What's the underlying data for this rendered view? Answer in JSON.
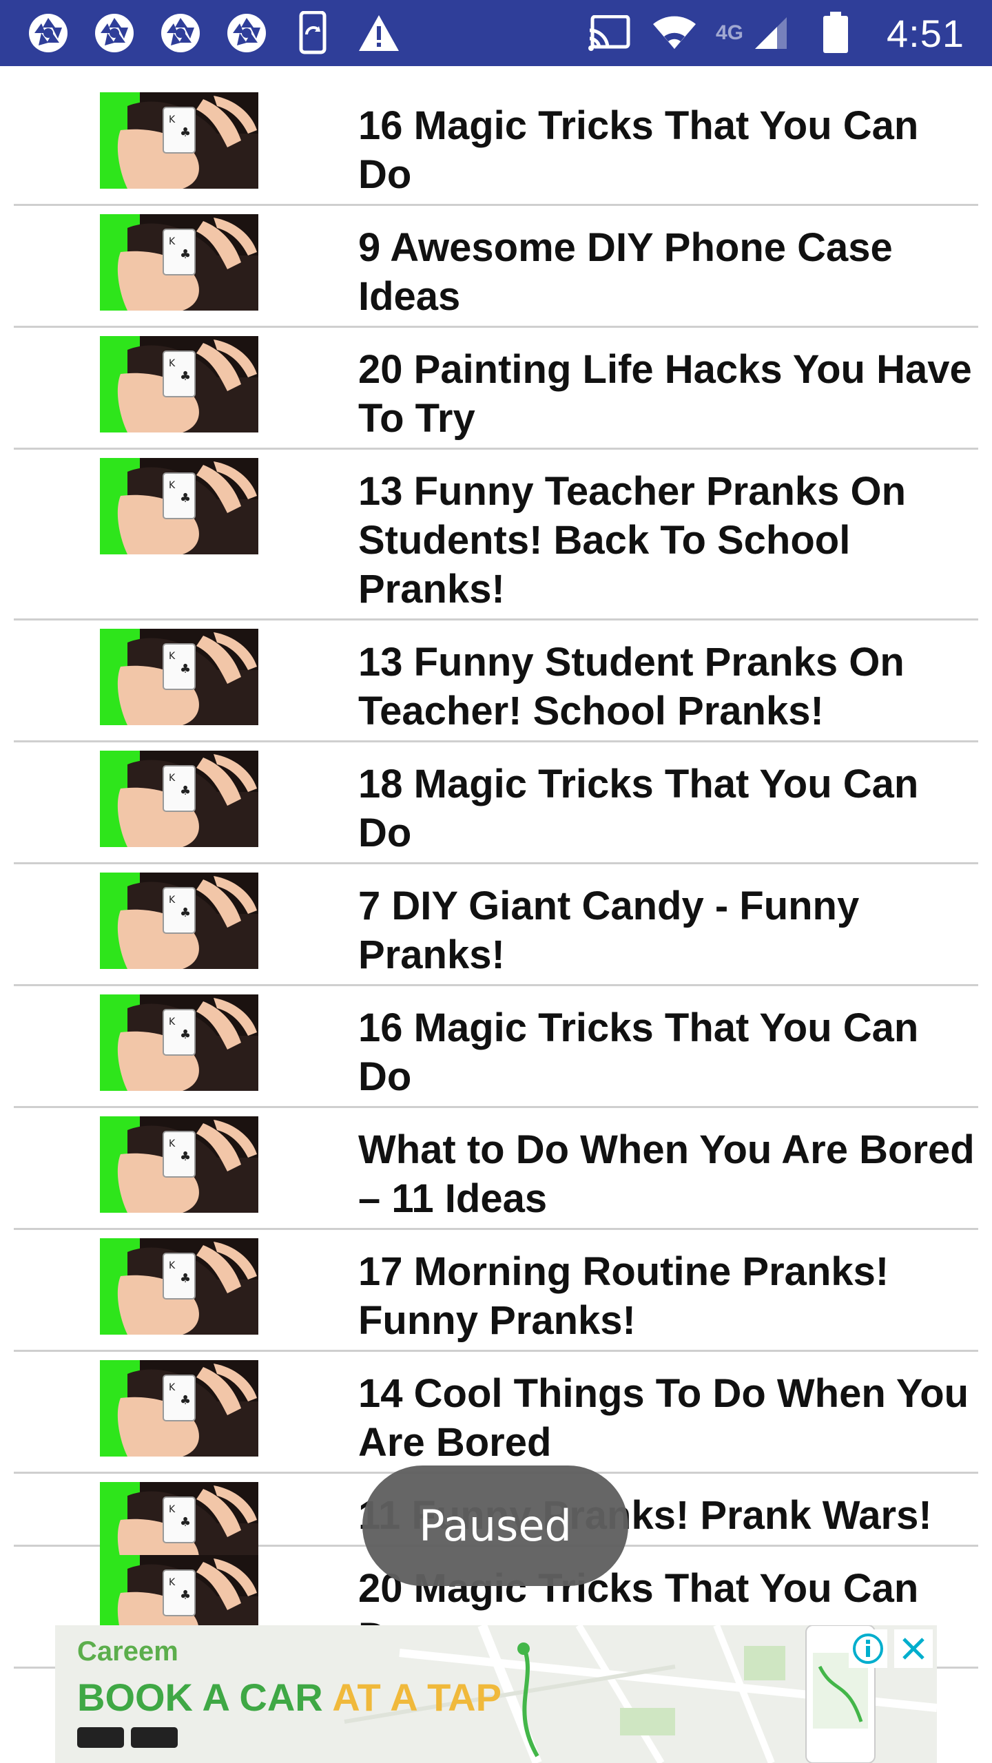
{
  "status_bar": {
    "clock": "4:51",
    "network_label": "4G",
    "left_icons": [
      "camera-shutter-icon",
      "camera-shutter-icon",
      "camera-shutter-icon",
      "camera-shutter-icon",
      "phone-rotate-icon",
      "warning-icon"
    ],
    "right_icons": [
      "cast-icon",
      "wifi-icon",
      "signal-icon",
      "battery-icon"
    ],
    "bg_color": "#2f3e99"
  },
  "list": {
    "items": [
      {
        "title": "16 Magic Tricks That You Can Do"
      },
      {
        "title": "9 Awesome DIY Phone Case Ideas"
      },
      {
        "title": "20 Painting Life Hacks You Have To Try"
      },
      {
        "title": "13 Funny Teacher Pranks On Students! Back To School Pranks!"
      },
      {
        "title": "13 Funny Student Pranks On Teacher! School Pranks!"
      },
      {
        "title": "18 Magic Tricks That You Can Do"
      },
      {
        "title": "7 DIY Giant Candy - Funny Pranks!"
      },
      {
        "title": "16 Magic Tricks That You Can Do"
      },
      {
        "title": "What to Do When You Are Bored – 11 Ideas"
      },
      {
        "title": "17 Morning Routine Pranks! Funny Pranks!"
      },
      {
        "title": "14 Cool Things To Do When You Are Bored"
      },
      {
        "title": "11 Funny Pranks! Prank Wars!"
      },
      {
        "title": "20 Magic Tricks That You Can Do"
      }
    ]
  },
  "toast": {
    "text": "Paused"
  },
  "ad": {
    "brand": "Careem",
    "headline_main": "BOOK A CAR",
    "headline_accent": "AT A TAP",
    "info_icon": "info-icon",
    "close_icon": "close-icon"
  },
  "colors": {
    "thumb_green": "#2ee51b",
    "thumb_dark": "#1b1210",
    "skin": "#f2c6a8",
    "ad_green": "#3fa845",
    "ad_yellow": "#f0b93b"
  }
}
